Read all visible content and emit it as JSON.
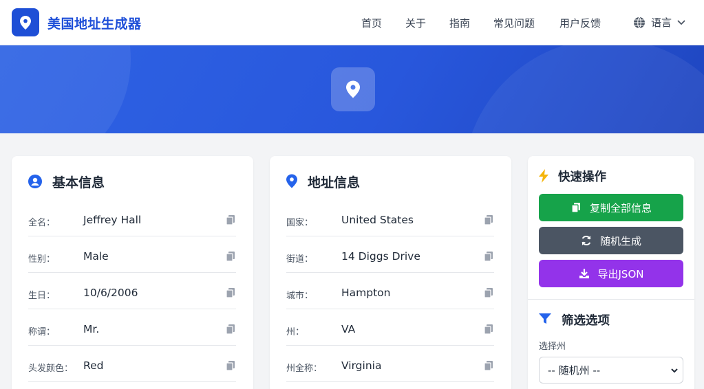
{
  "header": {
    "brand": "美国地址生成器",
    "nav": [
      "首页",
      "关于",
      "指南",
      "常见问题",
      "用户反馈"
    ],
    "language_label": "语言",
    "brand_color": "#1d4ed8"
  },
  "basic_info": {
    "title": "基本信息",
    "rows": [
      {
        "label": "全名：",
        "value": "Jeffrey Hall"
      },
      {
        "label": "性别：",
        "value": "Male"
      },
      {
        "label": "生日：",
        "value": "10/6/2006"
      },
      {
        "label": "称谓：",
        "value": "Mr."
      },
      {
        "label": "头发颜色：",
        "value": "Red"
      }
    ]
  },
  "address_info": {
    "title": "地址信息",
    "rows": [
      {
        "label": "国家：",
        "value": "United States"
      },
      {
        "label": "街道：",
        "value": "14 Diggs Drive"
      },
      {
        "label": "城市：",
        "value": "Hampton"
      },
      {
        "label": "州：",
        "value": "VA"
      },
      {
        "label": "州全称：",
        "value": "Virginia"
      }
    ]
  },
  "quick_actions": {
    "title": "快速操作",
    "copy_all": "复制全部信息",
    "random": "随机生成",
    "export_json": "导出JSON",
    "colors": {
      "green": "#16a34a",
      "gray": "#4b5563",
      "purple": "#9333ea"
    }
  },
  "filters": {
    "title": "筛选选项",
    "state_label": "选择州",
    "state_selected": "-- 随机州 --"
  },
  "icons": [
    "map-pin-icon",
    "globe-icon",
    "chevron-down-icon",
    "user-circle-icon",
    "copy-icon",
    "bolt-icon",
    "refresh-icon",
    "download-icon",
    "filter-icon"
  ]
}
